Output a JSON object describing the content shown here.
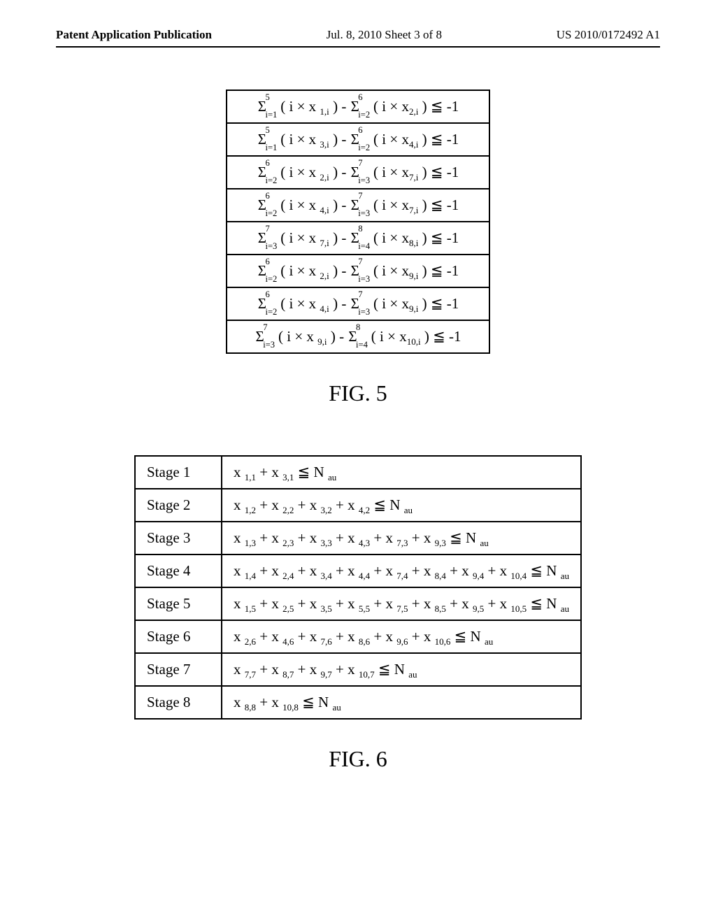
{
  "header": {
    "left": "Patent Application Publication",
    "center": "Jul. 8, 2010   Sheet 3 of 8",
    "right": "US 2010/0172492 A1"
  },
  "fig5": {
    "rows": [
      "Σ⁵ᵢ₌₁ ( i × x ₁,ᵢ ) − Σ⁶ᵢ₌₂ ( i × x₂,ᵢ ) ≦ -1",
      "Σ⁵ᵢ₌₁ ( i × x ₃,ᵢ ) − Σ⁶ᵢ₌₂ ( i × x₄,ᵢ ) ≦ -1",
      "Σ⁶ᵢ₌₂ ( i × x ₂,ᵢ ) − Σ⁷ᵢ₌₃ ( i × x₇,ᵢ ) ≦ -1",
      "Σ⁶ᵢ₌₂ ( i × x ₄,ᵢ ) − Σ⁷ᵢ₌₃ ( i × x₇,ᵢ ) ≦ -1",
      "Σ⁷ᵢ₌₃ ( i × x ₇,ᵢ ) − Σ⁸ᵢ₌₄ ( i × x₈,ᵢ ) ≦ -1",
      "Σ⁶ᵢ₌₂ ( i × x ₂,ᵢ ) − Σ⁷ᵢ₌₃ ( i × x₉,ᵢ ) ≦ -1",
      "Σ⁶ᵢ₌₂ ( i × x ₄,ᵢ ) − Σ⁷ᵢ₌₃ ( i × x₉,ᵢ ) ≦ -1",
      "Σ⁷ᵢ₌₃ ( i × x ₉,ᵢ ) − Σ⁸ᵢ₌₄ ( i × x₁₀,ᵢ ) ≦ -1"
    ],
    "caption": "FIG. 5"
  },
  "fig6": {
    "rows": [
      {
        "stage": "Stage 1",
        "expr": "x ₁,₁ + x ₃,₁ ≦ N ₐᵤ"
      },
      {
        "stage": "Stage 2",
        "expr": "x ₁,₂ + x ₂,₂ + x ₃,₂ + x ₄,₂ ≦ N ₐᵤ"
      },
      {
        "stage": "Stage 3",
        "expr": "x ₁,₃ + x ₂,₃ + x ₃,₃ + x ₄,₃ + x ₇,₃ + x ₉,₃ ≦ N ₐᵤ"
      },
      {
        "stage": "Stage 4",
        "expr": "x ₁,₄ + x ₂,₄ + x ₃,₄ + x ₄,₄ + x ₇,₄ + x ₈,₄ + x ₉,₄ + x ₁₀,₄ ≦ N ₐᵤ"
      },
      {
        "stage": "Stage 5",
        "expr": "x ₁,₅ + x ₂,₅ + x ₃,₅ + x ₅,₅ + x ₇,₅ + x ₈,₅ + x ₉,₅ + x ₁₀,₅ ≦ N ₐᵤ"
      },
      {
        "stage": "Stage 6",
        "expr": "x ₂,₆ + x ₄,₆ + x ₇,₆ + x ₈,₆ + x ₉,₆ + x ₁₀,₆ ≦ N ₐᵤ"
      },
      {
        "stage": "Stage 7",
        "expr": "x ₇,₇ + x ₈,₇ + x ₉,₇ + x ₁₀,₇ ≦ N ₐᵤ"
      },
      {
        "stage": "Stage 8",
        "expr": "x ₈,₈ + x ₁₀,₈ ≦ N ₐᵤ"
      }
    ],
    "caption": "FIG. 6"
  }
}
